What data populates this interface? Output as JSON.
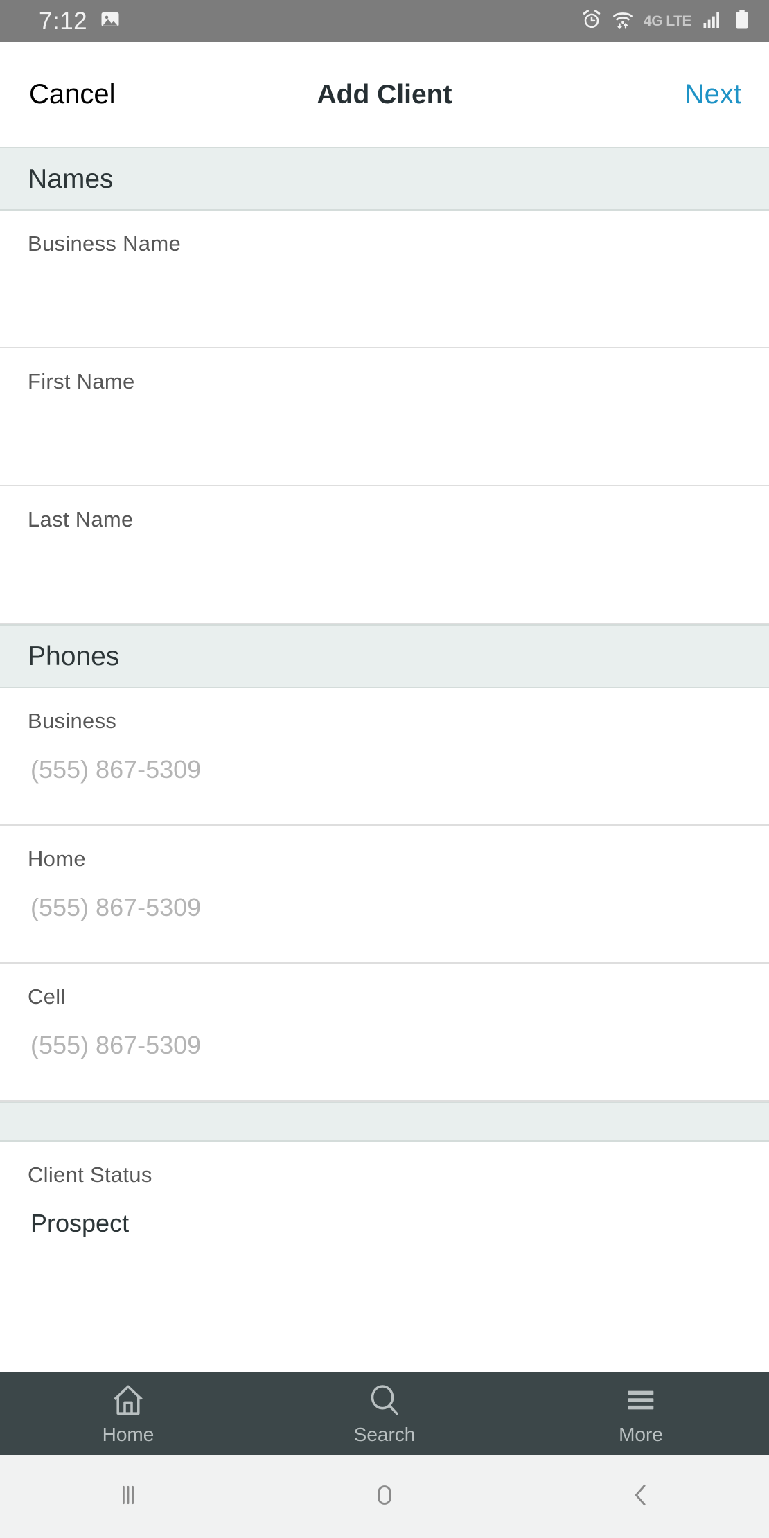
{
  "status_bar": {
    "time": "7:12",
    "left_icons": [
      "image-icon"
    ],
    "right_icons": [
      "alarm-icon",
      "wifi-icon",
      "signal-icon",
      "battery-icon"
    ],
    "network_label": "4G LTE",
    "background": "#7c7c7c"
  },
  "navbar": {
    "cancel_label": "Cancel",
    "title": "Add Client",
    "next_label": "Next",
    "next_color": "#1f93c6"
  },
  "sections": [
    {
      "title": "Names",
      "fields": [
        {
          "label": "Business Name",
          "value": "",
          "placeholder": ""
        },
        {
          "label": "First Name",
          "value": "",
          "placeholder": ""
        },
        {
          "label": "Last Name",
          "value": "",
          "placeholder": ""
        }
      ]
    },
    {
      "title": "Phones",
      "fields": [
        {
          "label": "Business",
          "value": "",
          "placeholder": "(555) 867-5309"
        },
        {
          "label": "Home",
          "value": "",
          "placeholder": "(555) 867-5309"
        },
        {
          "label": "Cell",
          "value": "",
          "placeholder": "(555) 867-5309"
        }
      ]
    },
    {
      "title": "",
      "fields": [
        {
          "label": "Client Status",
          "value": "Prospect",
          "placeholder": ""
        }
      ]
    }
  ],
  "section_colors": {
    "header_background": "#e9efee",
    "header_border": "#d4dcda",
    "row_separator": "#dedede",
    "label_text": "#575757",
    "value_text": "#2d3638",
    "placeholder_text": "#b4b4b4"
  },
  "tabbar": {
    "background": "#3c4749",
    "tint": "#b9c0c1",
    "items": [
      {
        "icon": "home-icon",
        "label": "Home"
      },
      {
        "icon": "search-icon",
        "label": "Search"
      },
      {
        "icon": "more-icon",
        "label": "More"
      }
    ]
  },
  "android_nav": {
    "background": "#f1f2f2",
    "tint": "#8a8a8a",
    "items": [
      {
        "icon": "recents-icon"
      },
      {
        "icon": "home-circle-icon"
      },
      {
        "icon": "back-chevron-icon"
      }
    ]
  }
}
